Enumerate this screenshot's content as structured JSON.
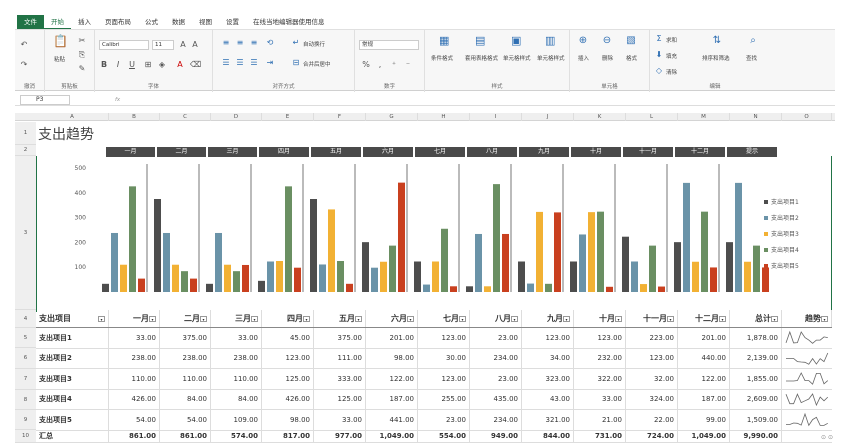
{
  "tabs": [
    "文件",
    "开始",
    "插入",
    "页面布局",
    "公式",
    "数据",
    "视图",
    "设置",
    "在线当地编辑器使用信息"
  ],
  "toolbar": {
    "paste": "粘贴",
    "font_name": "Calibri",
    "font_size": "11",
    "number_format": "常规",
    "wrap_text": "自动换行",
    "merge_center": "合并后居中",
    "conditional": "条件格式",
    "table_format": "套用表格格式",
    "cell_style": "单元格样式",
    "cell_style2": "单元格样式",
    "insert": "插入",
    "delete": "删除",
    "format": "格式",
    "autosum": "求和",
    "fill": "填充",
    "clear": "清除",
    "sort_filter": "排序和筛选",
    "find": "查找",
    "groups": [
      "撤消",
      "剪贴板",
      "字体",
      "对齐方式",
      "数字",
      "样式",
      "单元格",
      "编辑"
    ]
  },
  "namebox": "P3",
  "fx": "fx",
  "columns": [
    "A",
    "B",
    "C",
    "D",
    "E",
    "F",
    "G",
    "H",
    "I",
    "J",
    "K",
    "L",
    "M",
    "N",
    "O"
  ],
  "rows": [
    "1",
    "2",
    "3",
    "4",
    "5",
    "6",
    "7",
    "8",
    "9",
    "10"
  ],
  "title": "支出趋势",
  "month_headers": [
    "一月",
    "二月",
    "三月",
    "四月",
    "五月",
    "六月",
    "七月",
    "八月",
    "九月",
    "十月",
    "十一月",
    "十二月",
    "提示"
  ],
  "chart_data": {
    "type": "bar",
    "categories": [
      "一月",
      "二月",
      "三月",
      "四月",
      "五月",
      "六月",
      "七月",
      "八月",
      "九月",
      "十月",
      "十一月",
      "十二月",
      "总计"
    ],
    "ylim": [
      0,
      500
    ],
    "yticks": [
      100,
      200,
      300,
      400,
      500
    ],
    "legend_position": "right",
    "series": [
      {
        "name": "支出项目1",
        "color": "#4d4d4d",
        "values": [
          33,
          375,
          33,
          45,
          375,
          201,
          123,
          23,
          123,
          123,
          223,
          201,
          201
        ]
      },
      {
        "name": "支出项目2",
        "color": "#6a93a8",
        "values": [
          238,
          238,
          238,
          123,
          111,
          98,
          30,
          234,
          34,
          232,
          123,
          440,
          440
        ]
      },
      {
        "name": "支出项目3",
        "color": "#f2b134",
        "values": [
          110,
          110,
          110,
          125,
          333,
          122,
          123,
          23,
          323,
          322,
          32,
          122,
          122
        ]
      },
      {
        "name": "支出项目4",
        "color": "#6a8f62",
        "values": [
          426,
          84,
          84,
          426,
          125,
          187,
          255,
          435,
          33,
          324,
          187,
          324,
          187
        ]
      },
      {
        "name": "支出项目5",
        "color": "#c9401f",
        "values": [
          54,
          54,
          109,
          98,
          33,
          441,
          23,
          234,
          321,
          21,
          22,
          99,
          99
        ]
      }
    ]
  },
  "table": {
    "headers": [
      "支出项目",
      "一月",
      "二月",
      "三月",
      "四月",
      "五月",
      "六月",
      "七月",
      "八月",
      "九月",
      "十月",
      "十一月",
      "十二月",
      "总计",
      "趋势"
    ],
    "rows": [
      [
        "支出项目1",
        "33.00",
        "375.00",
        "33.00",
        "45.00",
        "375.00",
        "201.00",
        "123.00",
        "23.00",
        "123.00",
        "123.00",
        "223.00",
        "201.00",
        "1,878.00"
      ],
      [
        "支出项目2",
        "238.00",
        "238.00",
        "238.00",
        "123.00",
        "111.00",
        "98.00",
        "30.00",
        "234.00",
        "34.00",
        "232.00",
        "123.00",
        "440.00",
        "2,139.00"
      ],
      [
        "支出项目3",
        "110.00",
        "110.00",
        "110.00",
        "125.00",
        "333.00",
        "122.00",
        "123.00",
        "23.00",
        "323.00",
        "322.00",
        "32.00",
        "122.00",
        "1,855.00"
      ],
      [
        "支出项目4",
        "426.00",
        "84.00",
        "84.00",
        "426.00",
        "125.00",
        "187.00",
        "255.00",
        "435.00",
        "43.00",
        "33.00",
        "324.00",
        "187.00",
        "2,609.00"
      ],
      [
        "支出项目5",
        "54.00",
        "54.00",
        "109.00",
        "98.00",
        "33.00",
        "441.00",
        "23.00",
        "234.00",
        "321.00",
        "21.00",
        "22.00",
        "99.00",
        "1,509.00"
      ]
    ],
    "total": [
      "汇总",
      "861.00",
      "861.00",
      "574.00",
      "817.00",
      "977.00",
      "1,049.00",
      "554.00",
      "949.00",
      "844.00",
      "731.00",
      "724.00",
      "1,049.00",
      "9,990.00"
    ]
  }
}
